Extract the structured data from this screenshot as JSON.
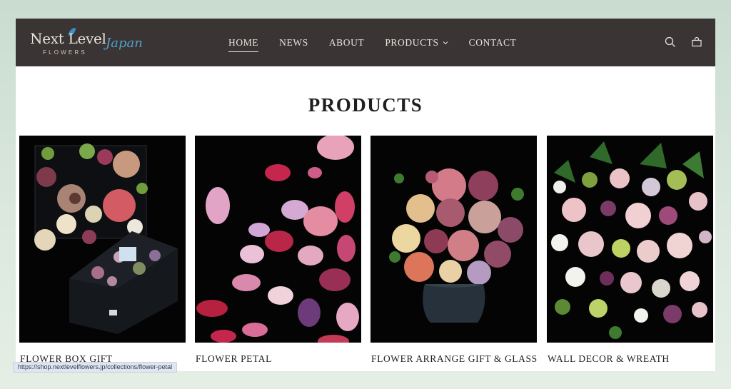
{
  "header": {
    "logo": {
      "main": "Next Level",
      "sub": "FLOWERS",
      "script": "Japan"
    },
    "nav": [
      {
        "label": "HOME",
        "active": true
      },
      {
        "label": "NEWS"
      },
      {
        "label": "ABOUT"
      },
      {
        "label": "PRODUCTS",
        "has_dropdown": true
      },
      {
        "label": "CONTACT"
      }
    ],
    "icons": [
      "search-icon",
      "cart-icon"
    ]
  },
  "main": {
    "title": "PRODUCTS",
    "products": [
      {
        "label": "FLOWER BOX GIFT"
      },
      {
        "label": "FLOWER PETAL"
      },
      {
        "label": "FLOWER ARRANGE GIFT & GLASS"
      },
      {
        "label": "WALL DECOR & WREATH"
      }
    ]
  },
  "status_bar": {
    "url": "https://shop.nextlevelflowers.jp/collections/flower-petal"
  },
  "colors": {
    "header_bg": "#3a3434",
    "accent_blue": "#4fa0cf",
    "page_bg": "#ffffff"
  }
}
